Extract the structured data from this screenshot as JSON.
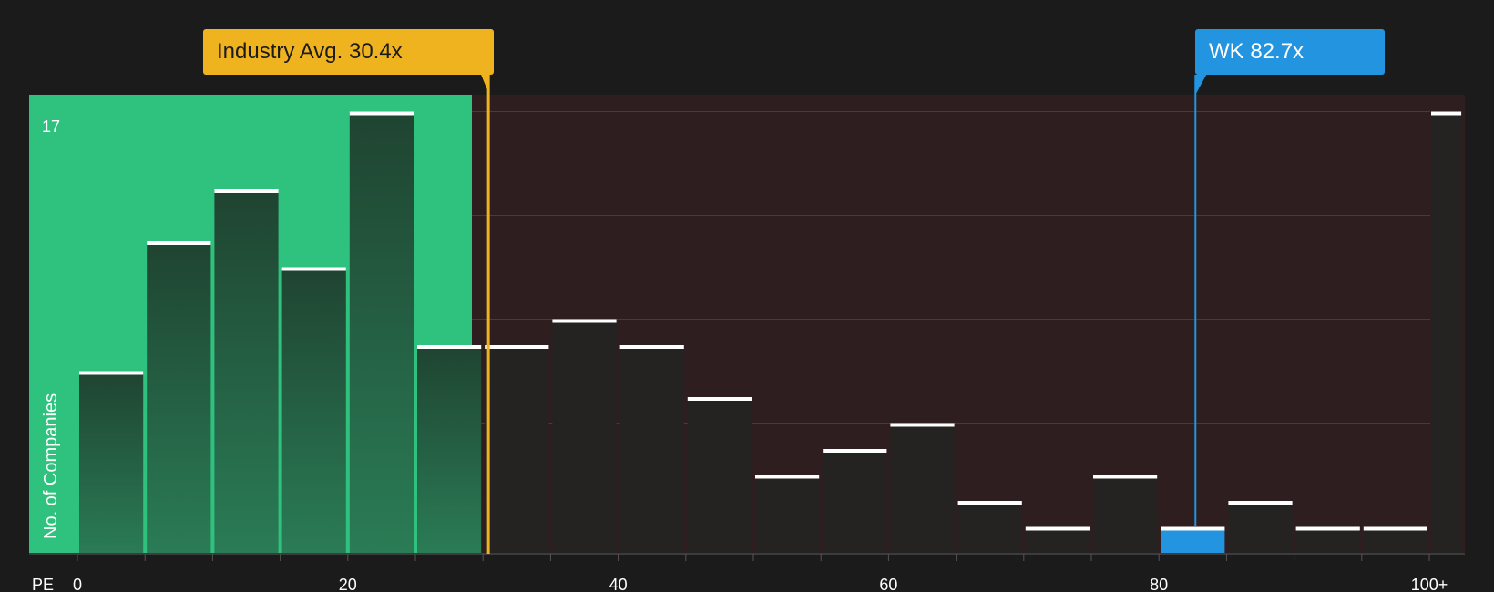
{
  "chart_data": {
    "type": "bar",
    "xlabel": "PE",
    "ylabel": "No. of Companies",
    "x_ticks": [
      "0",
      "20",
      "40",
      "60",
      "80",
      "100+"
    ],
    "y_max_label": "17",
    "ylim": [
      0,
      17
    ],
    "bins": [
      {
        "start": 0,
        "end": 5,
        "value": 7
      },
      {
        "start": 5,
        "end": 10,
        "value": 12
      },
      {
        "start": 10,
        "end": 15,
        "value": 14
      },
      {
        "start": 15,
        "end": 20,
        "value": 11
      },
      {
        "start": 20,
        "end": 25,
        "value": 17
      },
      {
        "start": 25,
        "end": 30,
        "value": 8
      },
      {
        "start": 30,
        "end": 35,
        "value": 8
      },
      {
        "start": 35,
        "end": 40,
        "value": 9
      },
      {
        "start": 40,
        "end": 45,
        "value": 8
      },
      {
        "start": 45,
        "end": 50,
        "value": 6
      },
      {
        "start": 50,
        "end": 55,
        "value": 3
      },
      {
        "start": 55,
        "end": 60,
        "value": 4
      },
      {
        "start": 60,
        "end": 65,
        "value": 5
      },
      {
        "start": 65,
        "end": 70,
        "value": 2
      },
      {
        "start": 70,
        "end": 75,
        "value": 1
      },
      {
        "start": 75,
        "end": 80,
        "value": 3
      },
      {
        "start": 80,
        "end": 85,
        "value": 1,
        "highlight": true
      },
      {
        "start": 85,
        "end": 90,
        "value": 2
      },
      {
        "start": 90,
        "end": 95,
        "value": 1
      },
      {
        "start": 95,
        "end": 100,
        "value": 1
      },
      {
        "start": 100,
        "end": 102.5,
        "value": 17
      }
    ],
    "industry_avg": {
      "label": "Industry Avg. 30.4x",
      "value": 30.4
    },
    "company": {
      "label": "WK 82.7x",
      "value": 82.7
    },
    "colors": {
      "background": "#1b1b1b",
      "fair_region": "#2ec27e",
      "over_region": "#2e1e1f",
      "bar_dark": "#252321",
      "bar_top": "#ffffff",
      "industry": "#efb31f",
      "company": "#2394e0"
    }
  }
}
